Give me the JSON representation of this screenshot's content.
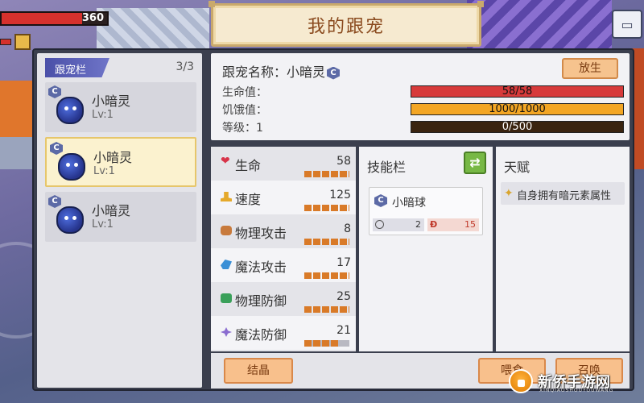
{
  "hud": {
    "hp_text": "360",
    "hp_fraction": 0.76
  },
  "title": "我的跟宠",
  "pet_list": {
    "header": "跟宠栏",
    "count": "3/3",
    "items": [
      {
        "badge": "C",
        "name": "小暗灵",
        "level": "Lv:1",
        "selected": false
      },
      {
        "badge": "C",
        "name": "小暗灵",
        "level": "Lv:1",
        "selected": true
      },
      {
        "badge": "C",
        "name": "小暗灵",
        "level": "Lv:1",
        "selected": false
      }
    ]
  },
  "info": {
    "name_label": "跟宠名称：小暗灵",
    "badge": "C",
    "release_label": "放生",
    "stats": [
      {
        "label": "生命值：",
        "text": "58/58",
        "fraction": 1.0
      },
      {
        "label": "饥饿值：",
        "text": "1000/1000",
        "fraction": 1.0
      },
      {
        "label": "等级：1",
        "text": "0/500",
        "fraction": 0.0
      }
    ]
  },
  "attributes": [
    {
      "label": "生命",
      "value": "58",
      "icon": "heart-icon",
      "color": "#d8344a",
      "pips": 5
    },
    {
      "label": "速度",
      "value": "125",
      "icon": "boot-icon",
      "color": "#e5a92b",
      "pips": 5
    },
    {
      "label": "物理攻击",
      "value": "8",
      "icon": "fist-icon",
      "color": "#c87a3c",
      "pips": 5
    },
    {
      "label": "魔法攻击",
      "value": "17",
      "icon": "magic-hand-icon",
      "color": "#3a8fd6",
      "pips": 5
    },
    {
      "label": "物理防御",
      "value": "25",
      "icon": "armor-icon",
      "color": "#3aa05a",
      "pips": 5
    },
    {
      "label": "魔法防御",
      "value": "21",
      "icon": "snowflake-shield-icon",
      "color": "#8a6cd0",
      "pips": 4
    }
  ],
  "skills": {
    "header": "技能栏",
    "swap_icon": "swap-icon",
    "items": [
      {
        "badge": "C",
        "name": "小暗球",
        "cooldown": "2",
        "damage": "15"
      }
    ]
  },
  "talent": {
    "header": "天赋",
    "items": [
      {
        "icon": "sparkle-icon",
        "text": "自身拥有暗元素属性"
      }
    ]
  },
  "buttons": {
    "crystal": "结晶",
    "feed": "喂食",
    "summon": "召唤"
  },
  "watermark": {
    "title": "新侨手游网",
    "sub": "XINQIAOSHOUYOUWANG"
  }
}
